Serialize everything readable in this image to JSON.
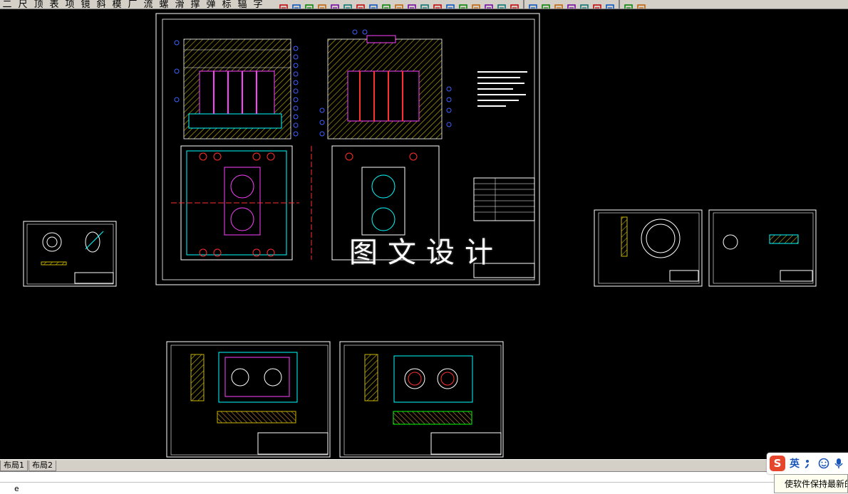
{
  "toolbar": {
    "menu_chars": [
      "二",
      "尺",
      "顶",
      "表",
      "项",
      "镜",
      "斜",
      "模",
      "厂",
      "流",
      "螺",
      "滑",
      "撑",
      "弹",
      "标",
      "辐",
      "字"
    ],
    "icons": [
      "library-icon",
      "pen-icon",
      "block-icon",
      "line-icon",
      "circle-icon",
      "spring-icon",
      "bolt-icon",
      "pin-icon",
      "insert-icon",
      "hook-icon",
      "tool-icon",
      "screw-icon",
      "gear-icon",
      "target-icon",
      "vert-line-icon",
      "grid-icon",
      "graph-icon",
      "zoom-icon",
      "layout-icon",
      "flag-icon",
      "shield-icon",
      "triangle-icon",
      "tree-icon",
      "cone-icon",
      "window-icon",
      "arrow-icon",
      "link-icon",
      "cancel-icon"
    ]
  },
  "drawing": {
    "watermark": "图文设计",
    "colors": {
      "background": "#000000",
      "frame": "#ffffff",
      "hatch": "#c8b400",
      "cyan": "#00ffff",
      "magenta": "#ff40ff",
      "blue": "#4060ff",
      "red": "#ff3030",
      "green": "#00ff00",
      "yellow": "#ffff00"
    }
  },
  "tabs": {
    "layout1": "布局1",
    "layout2": "布局2"
  },
  "command": {
    "prompt": "e"
  },
  "ime": {
    "logo": "S",
    "mode": "英",
    "notice": "使软件保持最新的"
  }
}
